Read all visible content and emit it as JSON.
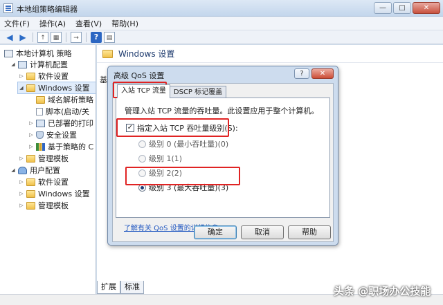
{
  "window": {
    "title": "本地组策略编辑器",
    "min": "—",
    "max": "□",
    "close": "✕"
  },
  "menu": [
    "文件(F)",
    "操作(A)",
    "查看(V)",
    "帮助(H)"
  ],
  "toolbar": {
    "help": "?"
  },
  "tree": [
    {
      "label": "本地计算机 策略",
      "icon": "computer"
    },
    {
      "label": "计算机配置",
      "icon": "pc"
    },
    {
      "label": "软件设置",
      "icon": "folder"
    },
    {
      "label": "Windows 设置",
      "icon": "folder"
    },
    {
      "label": "域名解析策略",
      "icon": "folder"
    },
    {
      "label": "脚本(启动/关",
      "icon": "doc"
    },
    {
      "label": "已部署的打印",
      "icon": "pc"
    },
    {
      "label": "安全设置",
      "icon": "shield"
    },
    {
      "label": "基于策略的 C",
      "icon": "bars"
    },
    {
      "label": "管理模板",
      "icon": "folder"
    },
    {
      "label": "用户配置",
      "icon": "user"
    },
    {
      "label": "软件设置",
      "icon": "folder"
    },
    {
      "label": "Windows 设置",
      "icon": "folder"
    },
    {
      "label": "管理模板",
      "icon": "folder"
    }
  ],
  "right_pane": {
    "title": "Windows 设置",
    "side_text": "基"
  },
  "bottom_tabs": [
    "扩展",
    "标准"
  ],
  "watermark": "头条 @职场办公技能",
  "dialog": {
    "title": "高级 QoS 设置",
    "help_btn": "?",
    "close_btn": "✕",
    "tabs": [
      "入站 TCP 流量",
      "DSCP 标记覆盖"
    ],
    "description": "管理入站 TCP 流量的吞吐量。此设置应用于整个计算机。",
    "checkbox_label": "指定入站 TCP 吞吐量级别(S):",
    "checkbox_checked": true,
    "radios": [
      "级别 0 (最小吞吐量)(0)",
      "级别 1(1)",
      "级别 2(2)",
      "级别 3 (最大吞吐量)(3)"
    ],
    "selected_radio": 3,
    "link": "了解有关 QoS 设置的详细信息",
    "buttons": {
      "ok": "确定",
      "cancel": "取消",
      "help": "帮助"
    }
  }
}
